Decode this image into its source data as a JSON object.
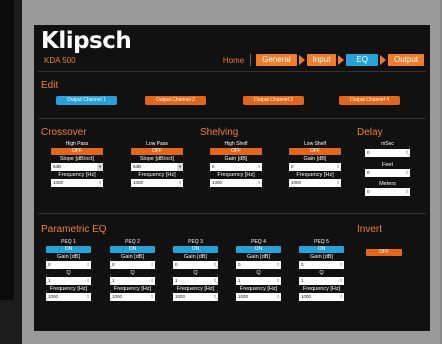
{
  "brand": "Klipsch",
  "model": "KDA 500",
  "nav": {
    "home": "Home",
    "tabs": [
      "General",
      "Input",
      "EQ",
      "Output"
    ],
    "active": "EQ"
  },
  "edit": {
    "title": "Edit",
    "channels": [
      "Output Channel 1",
      "Output Channel 2",
      "Output Channel 3",
      "Output Channel 4"
    ]
  },
  "crossover": {
    "title": "Crossover",
    "high_pass": {
      "label": "High Pass",
      "toggle": "OFF",
      "slope_label": "Slope [dB/oct]",
      "slope": "6dB",
      "freq_label": "Frequency [Hz]",
      "freq": "1000"
    },
    "low_pass": {
      "label": "Low Pass",
      "toggle": "OFF",
      "slope_label": "Slope [dB/oct]",
      "slope": "6dB",
      "freq_label": "Frequency [Hz]",
      "freq": "1000"
    }
  },
  "shelving": {
    "title": "Shelving",
    "high_shelf": {
      "label": "High Shelf",
      "toggle": "OFF",
      "gain_label": "Gain [dB]",
      "gain": "0",
      "freq_label": "Frequency [Hz]",
      "freq": "1000"
    },
    "low_shelf": {
      "label": "Low Shelf",
      "toggle": "OFF",
      "gain_label": "Gain [dB]",
      "gain": "0",
      "freq_label": "Frequency [Hz]",
      "freq": "1000"
    }
  },
  "delay": {
    "title": "Delay",
    "msec_label": "mSec",
    "msec": "0",
    "feet_label": "Feet",
    "feet": "0",
    "meters_label": "Meters",
    "meters": "0"
  },
  "peq": {
    "title": "Parametric EQ",
    "bands": [
      {
        "label": "PEQ 1",
        "toggle": "ON",
        "gain_label": "Gain [dB]",
        "gain": "0",
        "q_label": "Q",
        "q": "1",
        "freq_label": "Frequency [Hz]",
        "freq": "1000"
      },
      {
        "label": "PEQ 2",
        "toggle": "ON",
        "gain_label": "Gain [dB]",
        "gain": "0",
        "q_label": "Q",
        "q": "1",
        "freq_label": "Frequency [Hz]",
        "freq": "1000"
      },
      {
        "label": "PEQ 3",
        "toggle": "ON",
        "gain_label": "Gain [dB]",
        "gain": "0",
        "q_label": "Q",
        "q": "1",
        "freq_label": "Frequency [Hz]",
        "freq": "1000"
      },
      {
        "label": "PEQ 4",
        "toggle": "ON",
        "gain_label": "Gain [dB]",
        "gain": "0",
        "q_label": "Q",
        "q": "1",
        "freq_label": "Frequency [Hz]",
        "freq": "1000"
      },
      {
        "label": "PEQ 5",
        "toggle": "ON",
        "gain_label": "Gain [dB]",
        "gain": "0",
        "q_label": "Q",
        "q": "1",
        "freq_label": "Frequency [Hz]",
        "freq": "1000"
      }
    ]
  },
  "invert": {
    "title": "Invert",
    "toggle": "OFF"
  },
  "icons": {
    "spinner": "spinner-icon",
    "dropdown": "dropdown-arrow-icon",
    "nav_arrow": "chevron-right-icon"
  },
  "colors": {
    "accent": "#f07d2b",
    "active": "#27a2d9",
    "panel": "#111111"
  }
}
